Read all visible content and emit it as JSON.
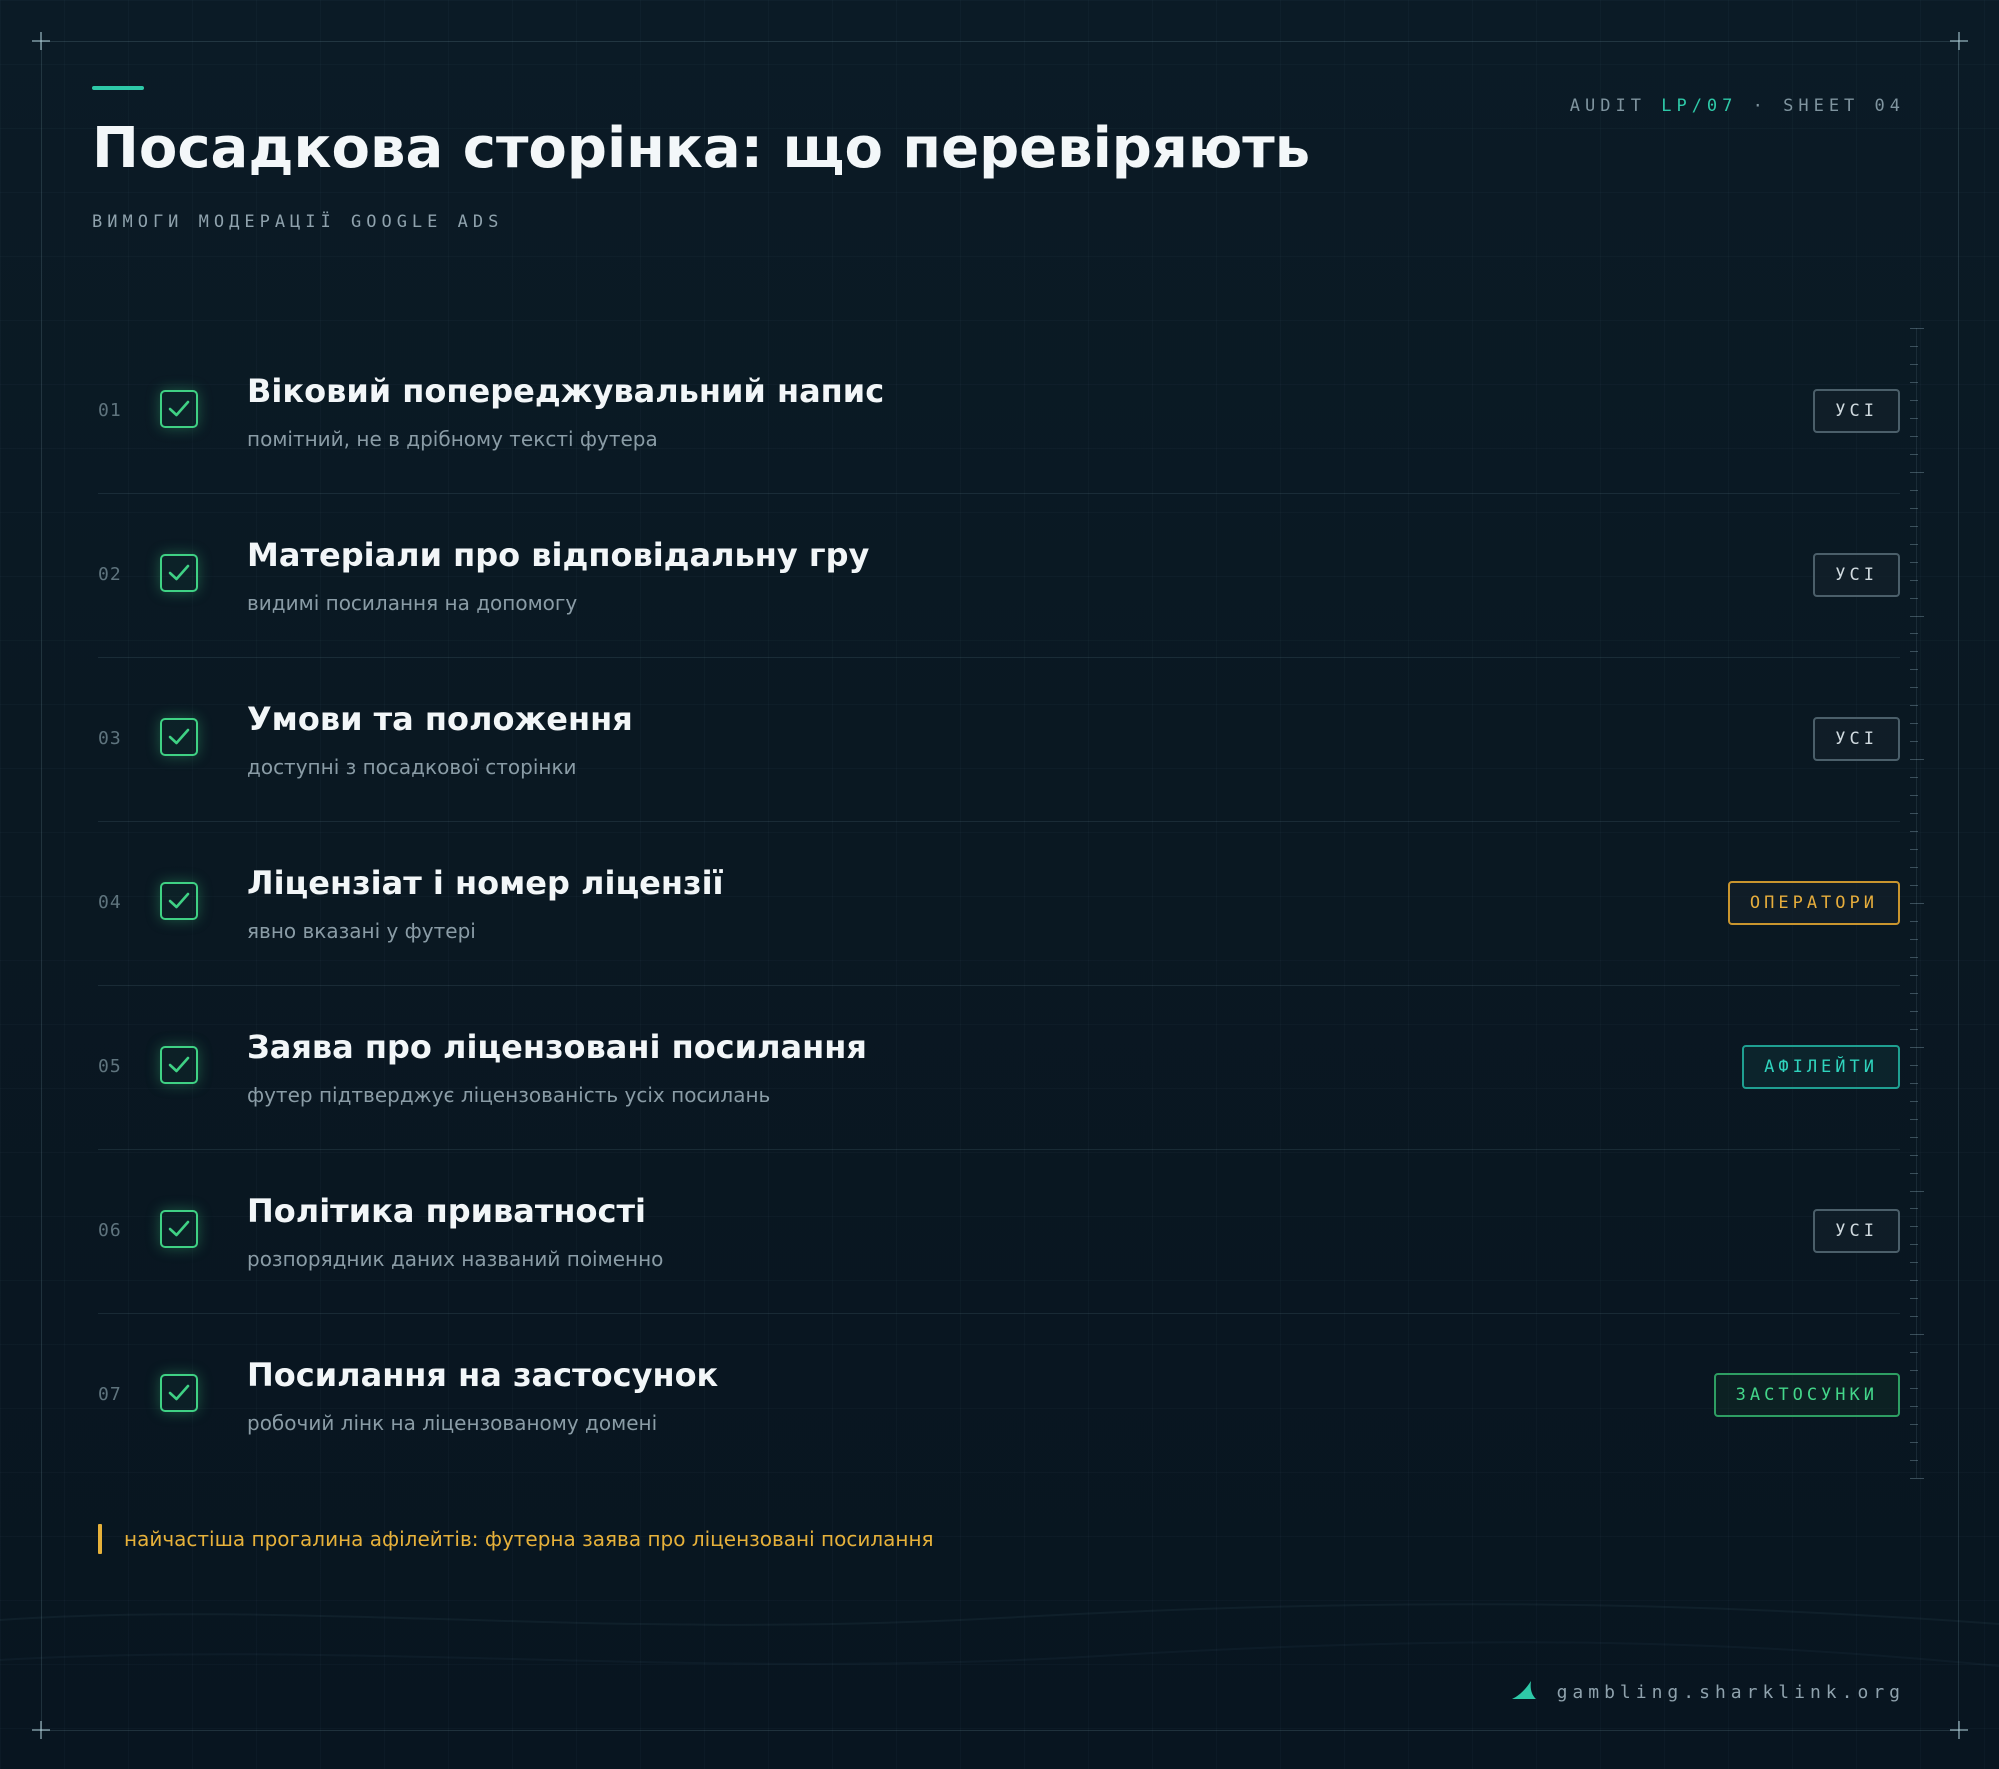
{
  "header": {
    "title": "Посадкова сторінка: що перевіряють",
    "subtitle": "ВИМОГИ МОДЕРАЦІЇ GOOGLE ADS",
    "meta_prefix": "AUDIT ",
    "meta_accent": "LP/07",
    "meta_suffix": " · SHEET 04"
  },
  "colors": {
    "accent": "#2ec9a8",
    "check": "#3fd184",
    "warning": "#e6b13a",
    "background": "#0b1b26"
  },
  "items": [
    {
      "num": "01",
      "title": "Віковий попереджувальний напис",
      "desc": "помітний, не в дрібному тексті футера",
      "badge": "УСІ",
      "checked": true
    },
    {
      "num": "02",
      "title": "Матеріали про відповідальну гру",
      "desc": "видимі посилання на допомогу",
      "badge": "УСІ",
      "checked": true
    },
    {
      "num": "03",
      "title": "Умови та положення",
      "desc": "доступні з посадкової сторінки",
      "badge": "УСІ",
      "checked": true
    },
    {
      "num": "04",
      "title": "Ліцензіат і номер ліцензії",
      "desc": "явно вказані у футері",
      "badge": "ОПЕРАТОРИ",
      "checked": true
    },
    {
      "num": "05",
      "title": "Заява про ліцензовані посилання",
      "desc": "футер підтверджує ліцензованість усіх посилань",
      "badge": "АФІЛЕЙТИ",
      "checked": true
    },
    {
      "num": "06",
      "title": "Політика приватності",
      "desc": "розпорядник даних названий поіменно",
      "badge": "УСІ",
      "checked": true
    },
    {
      "num": "07",
      "title": "Посилання на застосунок",
      "desc": "робочий лінк на ліцензованому домені",
      "badge": "ЗАСТОСУНКИ",
      "checked": true
    }
  ],
  "note": {
    "text": "найчастіша прогалина афілейтів: футерна заява про ліцензовані посилання"
  },
  "footer": {
    "icon": "shark-fin-icon",
    "domain": "gambling.sharklink.org"
  }
}
